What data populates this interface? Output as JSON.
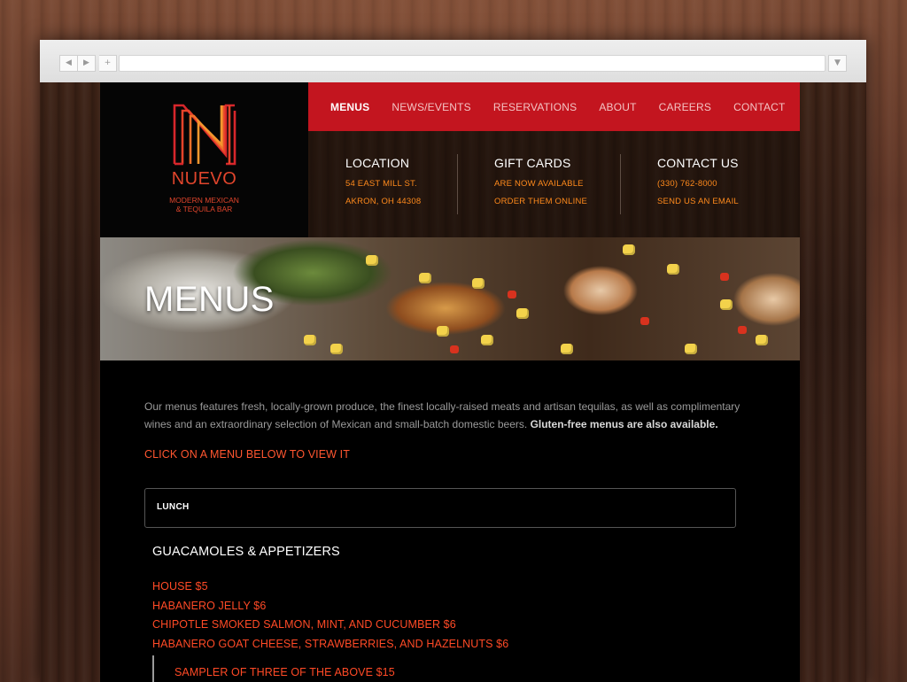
{
  "browser": {
    "back_icon": "◀",
    "forward_icon": "▶",
    "new_tab_icon": "+",
    "menu_icon": "▼"
  },
  "brand": {
    "name": "NUEVO",
    "tagline_line1": "MODERN MEXICAN",
    "tagline_line2": "& TEQUILA BAR",
    "accent_color": "#e0452c",
    "logo_icon": "nuevo-n-logo"
  },
  "nav": {
    "items": [
      {
        "label": "MENUS",
        "active": true
      },
      {
        "label": "NEWS/EVENTS",
        "active": false
      },
      {
        "label": "RESERVATIONS",
        "active": false
      },
      {
        "label": "ABOUT",
        "active": false
      },
      {
        "label": "CAREERS",
        "active": false
      },
      {
        "label": "CONTACT",
        "active": false
      }
    ],
    "bar_color": "#c3151f"
  },
  "info": {
    "location": {
      "title": "LOCATION",
      "line1": "54 EAST MILL ST.",
      "line2": "AKRON, OH 44308"
    },
    "gift_cards": {
      "title": "GIFT CARDS",
      "line1": "ARE NOW AVAILABLE",
      "line2": "ORDER THEM ONLINE"
    },
    "contact": {
      "title": "CONTACT US",
      "line1": "(330) 762-8000",
      "line2": "SEND US AN EMAIL"
    },
    "link_color": "#ff8a1c"
  },
  "hero": {
    "title": "MENUS"
  },
  "main": {
    "intro": "Our menus features fresh, locally-grown produce, the finest locally-raised meats and artisan tequilas, as well as complimentary wines and an extraordinary selection of Mexican and small-batch domestic beers.",
    "intro_bold": "Gluten-free menus are also available.",
    "cta": "CLICK ON A MENU BELOW TO VIEW IT",
    "menu_selector": "LUNCH",
    "section_title": "GUACAMOLES & APPETIZERS",
    "items": [
      "HOUSE $5",
      "HABANERO JELLY $6",
      "CHIPOTLE SMOKED SALMON, MINT, AND CUCUMBER $6",
      "HABANERO GOAT CHEESE, STRAWBERRIES, AND HAZELNUTS $6"
    ],
    "sub_item": "SAMPLER OF THREE OF THE ABOVE $15",
    "item_color": "#ff4a26"
  }
}
